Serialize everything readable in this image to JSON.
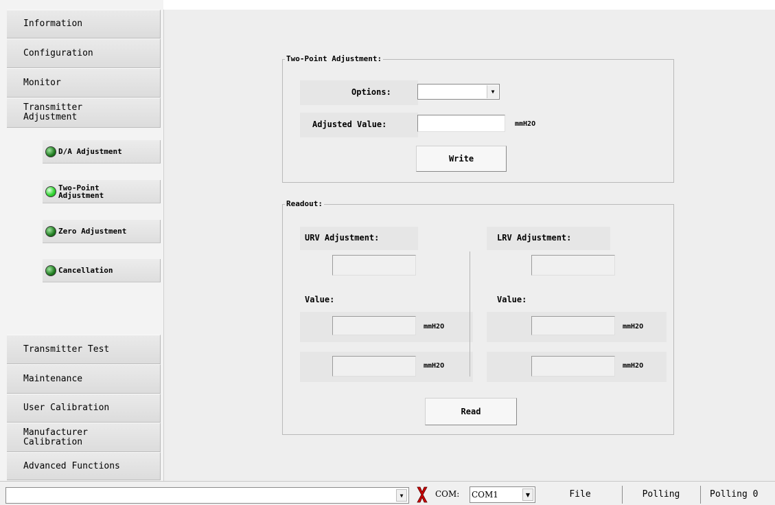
{
  "nav": {
    "items_top": [
      "Information",
      "Configuration",
      "Monitor",
      "Transmitter\nAdjustment"
    ],
    "sub_items": [
      {
        "label": "D/A Adjustment",
        "active": false
      },
      {
        "label": "Two-Point\nAdjustment",
        "active": true
      },
      {
        "label": "Zero Adjustment",
        "active": false
      },
      {
        "label": "Cancellation",
        "active": false
      }
    ],
    "items_bottom": [
      "Transmitter Test",
      "Maintenance",
      "User Calibration",
      "Manufacturer\nCalibration",
      "Advanced Functions"
    ]
  },
  "two_point": {
    "group_label": "Two-Point Adjustment:",
    "options_label": "Options:",
    "options_value": "",
    "adjusted_label": "Adjusted Value:",
    "adjusted_value": "",
    "unit": "mmH2O",
    "write_label": "Write"
  },
  "readout": {
    "group_label": "Readout:",
    "urv_label": "URV Adjustment:",
    "lrv_label": "LRV Adjustment:",
    "value_label": "Value:",
    "unit": "mmH2O",
    "read_label": "Read"
  },
  "statusbar": {
    "message": "",
    "com_label": "COM:",
    "com_value": "COM1",
    "file_label": "File",
    "polling_label": "Polling",
    "polling_count": "Polling 0"
  },
  "colors": {
    "led_on": "#33d633",
    "led_off": "#1f7a1f",
    "disconnect": "#cc0000"
  },
  "icons": {
    "led": "status-led-icon",
    "disconnect": "disconnect-x-icon",
    "dropdown": "chevron-down-icon"
  }
}
